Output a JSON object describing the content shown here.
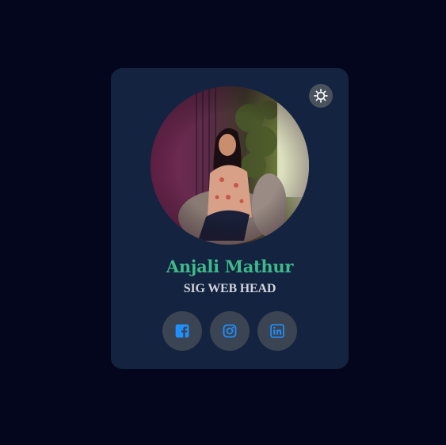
{
  "colors": {
    "page_background": "#03061c",
    "card_background": "#142340",
    "name_color": "#3fb98a",
    "icon_color": "#1e90ff",
    "button_background": "#3b4452"
  },
  "theme_toggle": {
    "icon": "gear-icon"
  },
  "profile": {
    "avatar": "profile-photo",
    "name": "Anjali Mathur",
    "role": "SIG WEB HEAD"
  },
  "socials": [
    {
      "icon": "facebook-icon"
    },
    {
      "icon": "instagram-icon"
    },
    {
      "icon": "linkedin-icon"
    }
  ]
}
